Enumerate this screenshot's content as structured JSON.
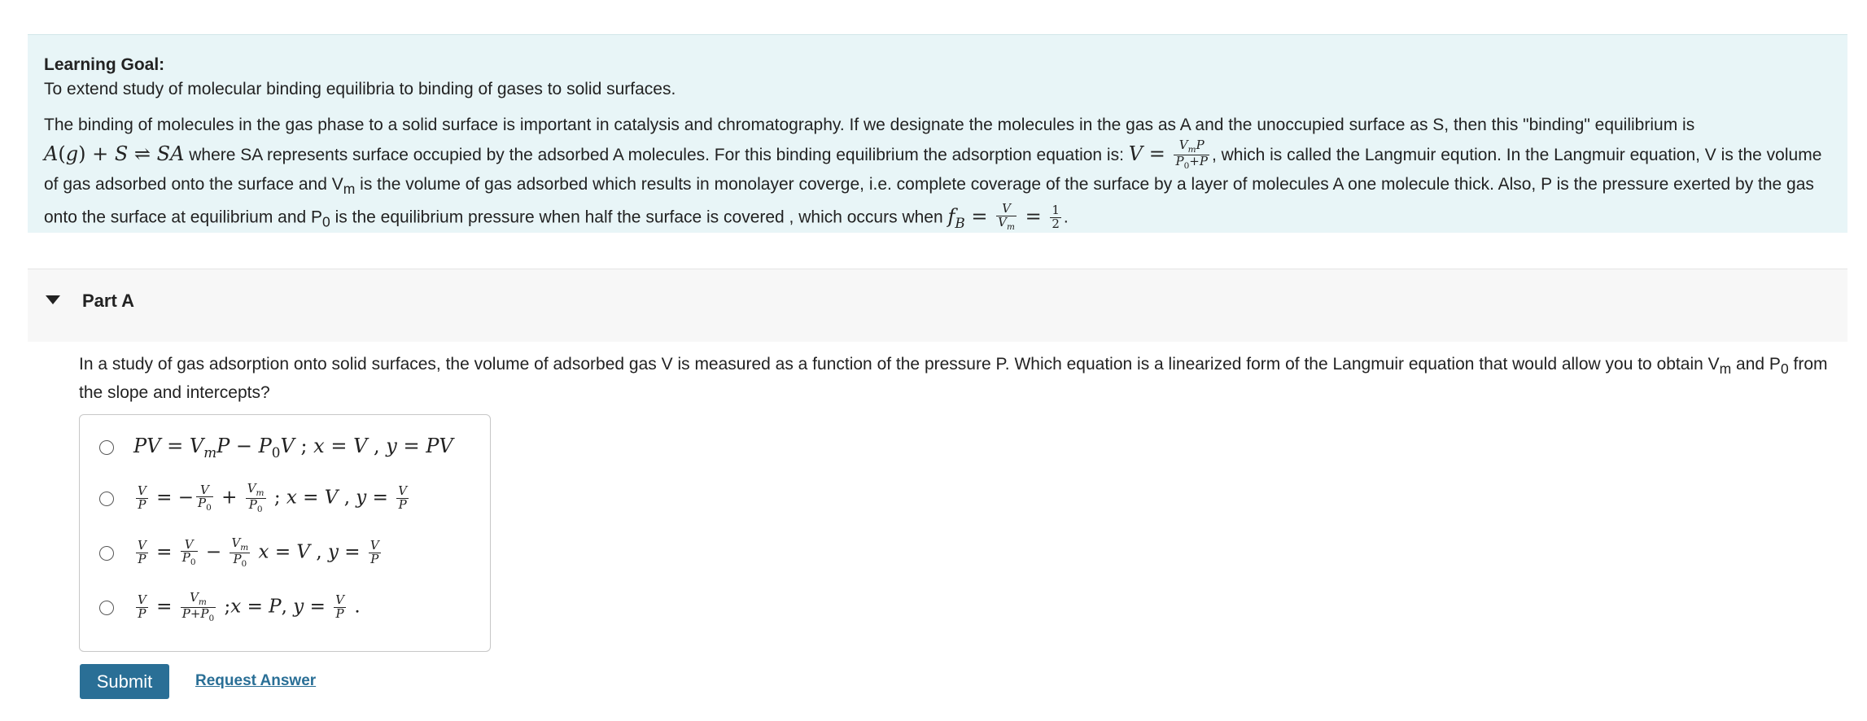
{
  "learning_goal": {
    "title": "Learning Goal:",
    "text": "To extend study of molecular binding equilibria to binding of gases to solid surfaces."
  },
  "intro": {
    "p1": "The binding of molecules in the gas phase to a solid surface is important in  catalysis and chromatography. If we designate the molecules in the gas as A and the unoccupied surface as S, then this \"binding\" equilibrium is",
    "p2": " where SA represents surface occupied by the adsorbed A molecules. For this binding equilibrium the adsorption equation is: ",
    "p3": ", which is called the Langmuir eqution. In the Langmuir equation, V is the volume of gas adsorbed onto the surface and V",
    "p3_sub": "m",
    "p4": " is the volume of gas adsorbed which results in monolayer coverge, i.e. complete coverage of the surface by a layer of molecules A one molecule thick. Also,  P is the pressure exerted by the gas onto the surface at equilibrium and P",
    "p4_sub": "0",
    "p5": " is the equilibrium pressure when half the surface is covered , which occurs when ",
    "p6": "."
  },
  "part_a": {
    "title": "Part A",
    "question_1": "In a study of gas adsorption onto solid surfaces, the volume of adsorbed gas V is measured as a function of the pressure P. Which equation is a linearized form of the Langmuir equation that would allow you to obtain V",
    "question_sub_1": "m",
    "question_2": " and P",
    "question_sub_2": "0",
    "question_3": " from the slope and intercepts?",
    "submit_label": "Submit",
    "request_label": "Request Answer"
  }
}
